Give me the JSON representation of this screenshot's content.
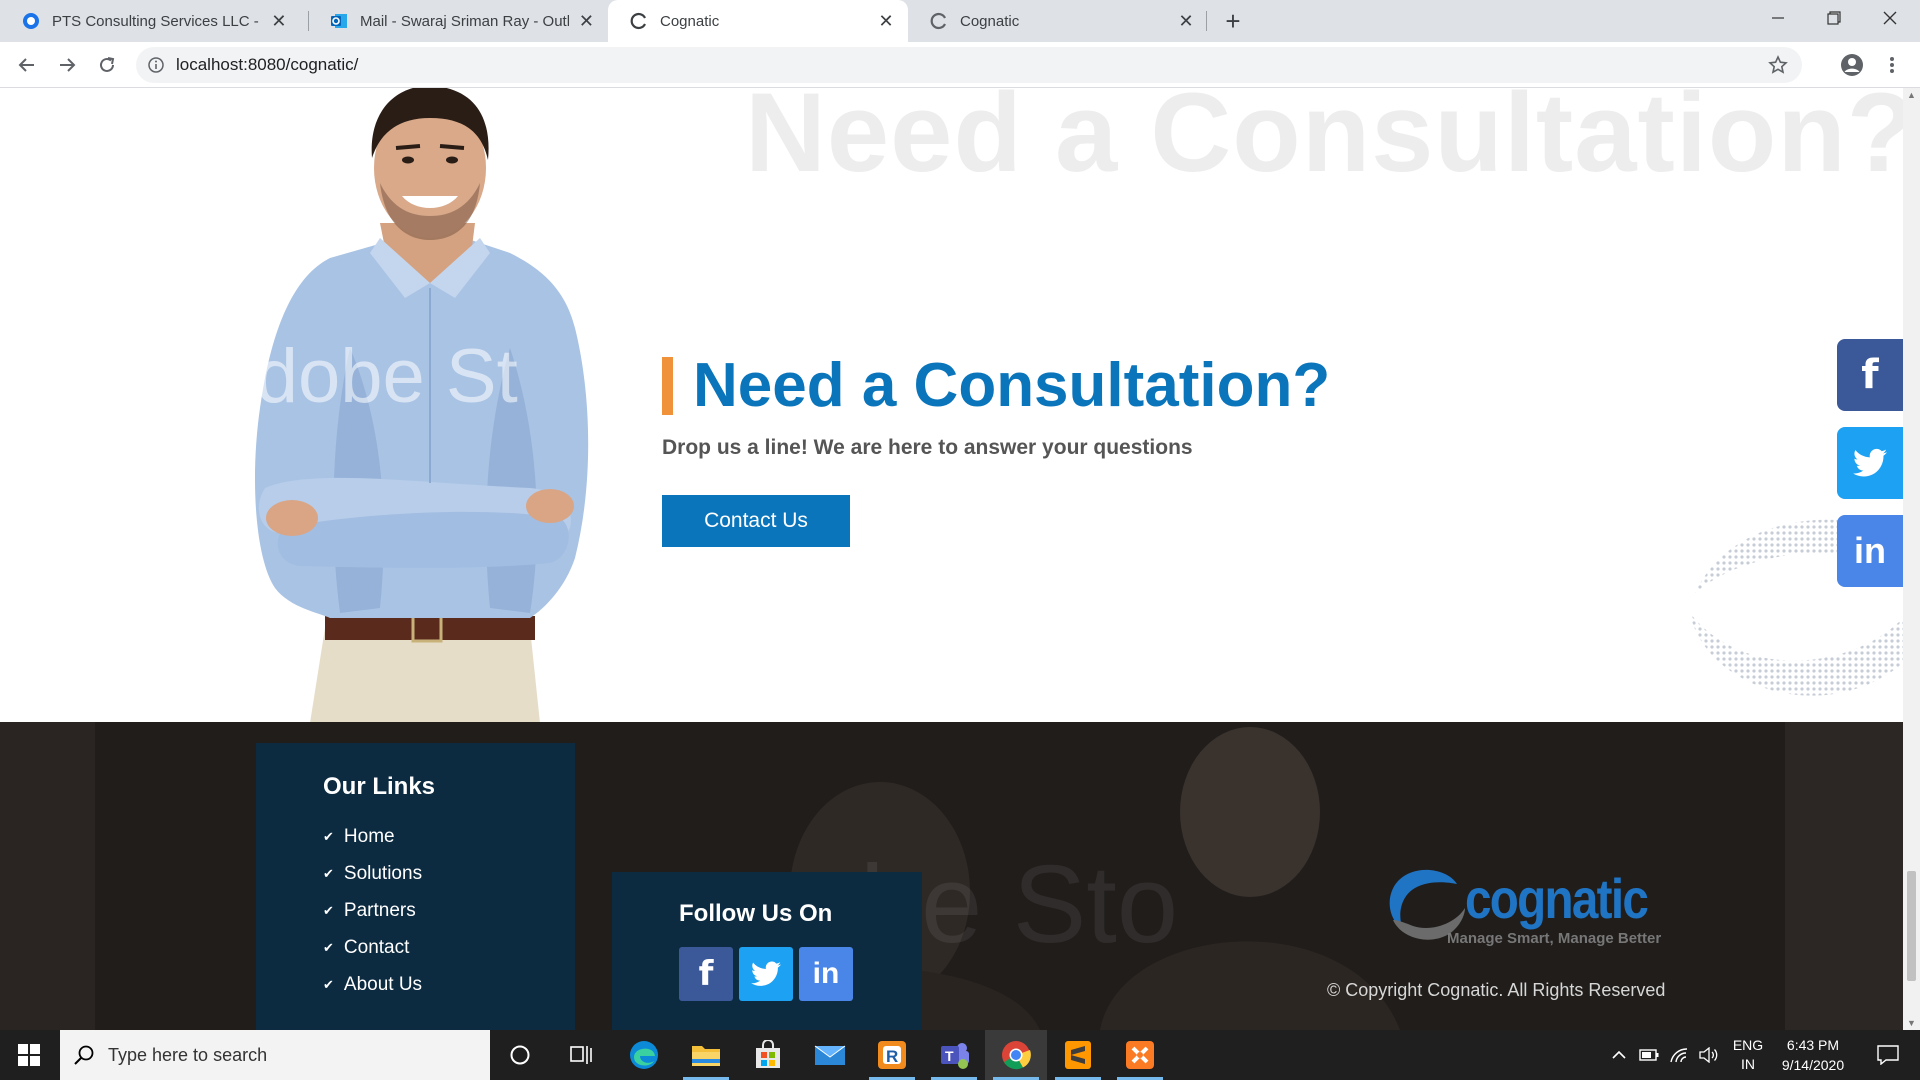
{
  "browser": {
    "tabs": [
      {
        "title": "PTS Consulting Services LLC - Sig",
        "active": false
      },
      {
        "title": "Mail - Swaraj Sriman Ray - Outlo",
        "active": false
      },
      {
        "title": "Cognatic",
        "active": true
      },
      {
        "title": "Cognatic",
        "active": false
      }
    ],
    "url": "localhost:8080/cognatic/"
  },
  "page": {
    "bg_heading": "Need a Consultation?",
    "watermark": "Adobe St",
    "cta": {
      "heading": "Need a Consultation?",
      "subtitle": "Drop us a line! We are here to answer your questions",
      "button": "Contact Us"
    },
    "social_float": [
      {
        "name": "facebook",
        "icon": "f",
        "color": "#3b5998"
      },
      {
        "name": "twitter",
        "icon": "twitter-bird",
        "color": "#1da1f2"
      },
      {
        "name": "linkedin",
        "icon": "in",
        "color": "#4a86e8"
      }
    ],
    "footer": {
      "links_title": "Our Links",
      "links": [
        "Home",
        "Solutions",
        "Partners",
        "Contact",
        "About Us"
      ],
      "follow_title": "Follow Us On",
      "brand_name": "cognatic",
      "brand_tagline": "Manage Smart, Manage Better",
      "copyright": "© Copyright Cognatic. All Rights Reserved"
    },
    "colors": {
      "primary": "#0b75bb",
      "accent": "#f0923a",
      "footer_box": "#0c2a40"
    }
  },
  "taskbar": {
    "search_placeholder": "Type here to search",
    "lang_line1": "ENG",
    "lang_line2": "IN",
    "time": "6:43 PM",
    "date": "9/14/2020"
  }
}
